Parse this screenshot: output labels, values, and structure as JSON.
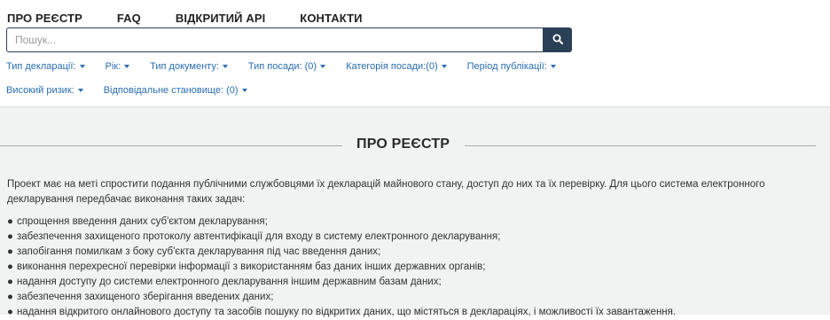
{
  "nav": {
    "items": [
      "ПРО РЕЄСТР",
      "FAQ",
      "ВІДКРИТИЙ API",
      "КОНТАКТИ"
    ]
  },
  "search": {
    "placeholder": "Пошук...",
    "value": ""
  },
  "filters": {
    "row1": [
      "Тип декларації:",
      "Рік:",
      "Тип документу:",
      "Тип посади: (0)",
      "Категорія посади:(0)",
      "Період публікації:"
    ],
    "row2": [
      "Високий ризик:",
      "Відповідальне становище: (0)"
    ]
  },
  "section": {
    "title": "ПРО РЕЄСТР",
    "intro": "Проект має на меті спростити подання публічними службовцями їх декларацій майнового стану, доступ до них та їх перевірку. Для цього система електронного декларування передбачає виконання таких задач:",
    "tasks": [
      "спрощення введення даних суб'єктом декларування;",
      "забезпечення захищеного протоколу автентифікації для входу в систему електронного декларування;",
      "запобігання помилкам з боку суб'єкта декларування під час введення даних;",
      "виконання перехресної перевірки інформації з використанням баз даних інших державних органів;",
      "надання доступу до системи електронного декларування іншим державним базам даних;",
      "забезпечення захищеного зберігання введених даних;",
      "надання відкритого онлайнового доступу та засобів пошуку по відкритих даних, що містяться в деклараціях, і можливості їх завантаження."
    ],
    "bullet": "●"
  },
  "colors": {
    "accent": "#2b3f57",
    "link": "#2a6db0",
    "content_bg": "#f1f2f2"
  },
  "icons": {
    "search_button": "search-icon",
    "filter_caret": "caret-down-icon"
  }
}
